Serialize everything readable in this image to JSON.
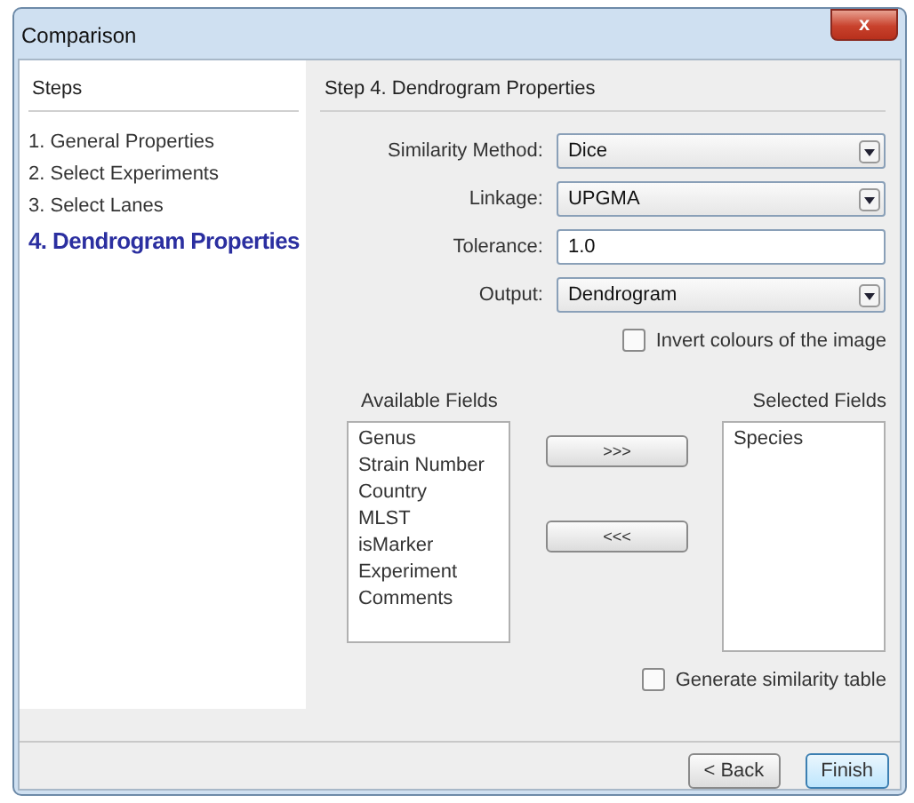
{
  "window": {
    "title": "Comparison",
    "close": "x"
  },
  "steps": {
    "title": "Steps",
    "items": [
      {
        "label": "1. General Properties",
        "selected": false
      },
      {
        "label": "2. Select Experiments",
        "selected": false
      },
      {
        "label": "3. Select Lanes",
        "selected": false
      },
      {
        "label": "4. Dendrogram Properties",
        "selected": true
      }
    ]
  },
  "panel": {
    "title": "Step 4. Dendrogram Properties",
    "fields": [
      {
        "kind": "dropdown",
        "label": "Similarity Method:",
        "value": "Dice"
      },
      {
        "kind": "dropdown",
        "label": "Linkage:",
        "value": "UPGMA"
      },
      {
        "kind": "text",
        "label": "Tolerance:",
        "value": "1.0"
      },
      {
        "kind": "dropdown",
        "label": "Output:",
        "value": "Dendrogram"
      }
    ],
    "invert": {
      "label": "Invert colours of the image",
      "checked": false
    },
    "available": {
      "title": "Available Fields",
      "items": [
        "Genus",
        "Strain Number",
        "Country",
        "MLST",
        "isMarker",
        "Experiment",
        "Comments"
      ]
    },
    "move_buttons": [
      ">>>",
      "<<<"
    ],
    "selected": {
      "title": "Selected Fields",
      "items": [
        "Species"
      ]
    },
    "similarity_table": {
      "label": "Generate similarity table",
      "checked": false
    }
  },
  "buttons": [
    {
      "label": "< Back",
      "default": false
    },
    {
      "label": "Finish",
      "default": true
    }
  ]
}
